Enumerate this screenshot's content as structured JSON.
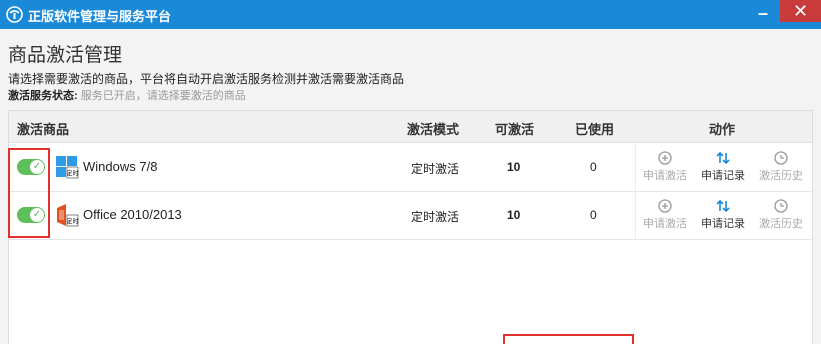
{
  "window": {
    "title": "正版软件管理与服务平台",
    "minimize_label": "–",
    "close_label": "✕"
  },
  "page": {
    "title": "商品激活管理",
    "instruction": "请选择需要激活的商品，平台将自动开启激活服务检测并激活需要激活商品",
    "status_label": "激活服务状态:",
    "status_value": "服务已开启，请选择要激活的商品"
  },
  "table": {
    "headers": {
      "product": "激活商品",
      "mode": "激活模式",
      "available": "可激活",
      "used": "已使用",
      "action": "动作"
    },
    "rows": [
      {
        "product": "Windows 7/8",
        "icon": "windows-icon",
        "icon_badge": "定时",
        "mode": "定时激活",
        "available": "10",
        "used": "0",
        "enabled": true
      },
      {
        "product": "Office 2010/2013",
        "icon": "office-icon",
        "icon_badge": "定时",
        "mode": "定时激活",
        "available": "10",
        "used": "0",
        "enabled": true
      }
    ],
    "actions": {
      "apply": "申请激活",
      "records": "申请记录",
      "history": "激活历史"
    }
  },
  "colors": {
    "titlebar": "#1a8ad8",
    "close": "#c93a3a",
    "toggle_on": "#5cbf5c",
    "highlight": "#e03030"
  }
}
